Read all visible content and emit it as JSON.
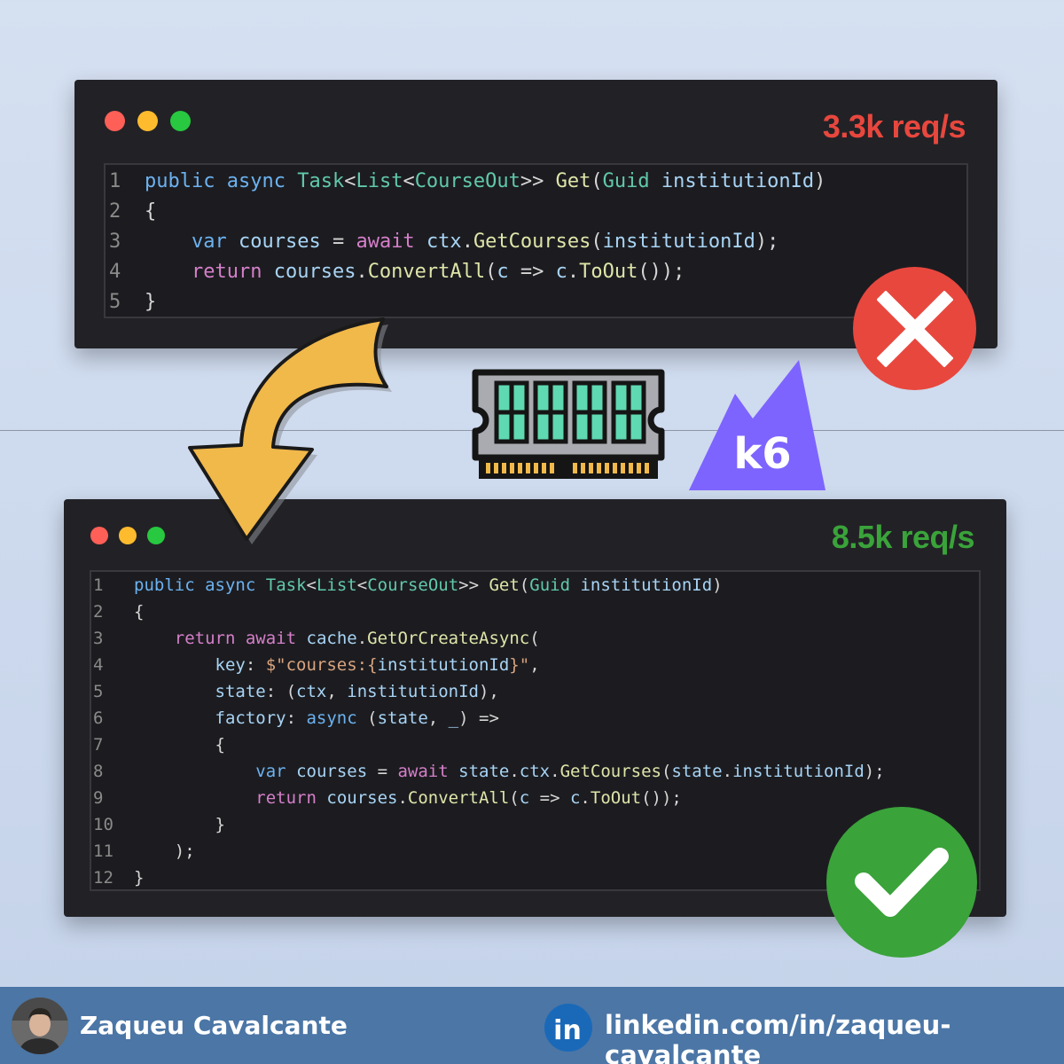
{
  "before": {
    "throughput": "3.3k req/s",
    "code": [
      [
        {
          "t": "public",
          "c": "kw"
        },
        {
          "t": " ",
          "c": "pl"
        },
        {
          "t": "async",
          "c": "kw"
        },
        {
          "t": " ",
          "c": "pl"
        },
        {
          "t": "Task",
          "c": "ty"
        },
        {
          "t": "<",
          "c": "pl"
        },
        {
          "t": "List",
          "c": "ty"
        },
        {
          "t": "<",
          "c": "pl"
        },
        {
          "t": "CourseOut",
          "c": "ty"
        },
        {
          "t": ">> ",
          "c": "pl"
        },
        {
          "t": "Get",
          "c": "fn"
        },
        {
          "t": "(",
          "c": "pl"
        },
        {
          "t": "Guid",
          "c": "ty"
        },
        {
          "t": " ",
          "c": "pl"
        },
        {
          "t": "institutionId",
          "c": "vr"
        },
        {
          "t": ")",
          "c": "pl"
        }
      ],
      [
        {
          "t": "{",
          "c": "pl"
        }
      ],
      [
        {
          "t": "    ",
          "c": "pl"
        },
        {
          "t": "var",
          "c": "kw"
        },
        {
          "t": " ",
          "c": "pl"
        },
        {
          "t": "courses",
          "c": "vr"
        },
        {
          "t": " = ",
          "c": "pl"
        },
        {
          "t": "await",
          "c": "ct"
        },
        {
          "t": " ",
          "c": "pl"
        },
        {
          "t": "ctx",
          "c": "vr"
        },
        {
          "t": ".",
          "c": "pl"
        },
        {
          "t": "GetCourses",
          "c": "fn"
        },
        {
          "t": "(",
          "c": "pl"
        },
        {
          "t": "institutionId",
          "c": "vr"
        },
        {
          "t": ");",
          "c": "pl"
        }
      ],
      [
        {
          "t": "    ",
          "c": "pl"
        },
        {
          "t": "return",
          "c": "ct"
        },
        {
          "t": " ",
          "c": "pl"
        },
        {
          "t": "courses",
          "c": "vr"
        },
        {
          "t": ".",
          "c": "pl"
        },
        {
          "t": "ConvertAll",
          "c": "fn"
        },
        {
          "t": "(",
          "c": "pl"
        },
        {
          "t": "c",
          "c": "vr"
        },
        {
          "t": " => ",
          "c": "pl"
        },
        {
          "t": "c",
          "c": "vr"
        },
        {
          "t": ".",
          "c": "pl"
        },
        {
          "t": "ToOut",
          "c": "fn"
        },
        {
          "t": "());",
          "c": "pl"
        }
      ],
      [
        {
          "t": "}",
          "c": "pl"
        }
      ]
    ]
  },
  "after": {
    "throughput": "8.5k req/s",
    "code": [
      [
        {
          "t": "public",
          "c": "kw"
        },
        {
          "t": " ",
          "c": "pl"
        },
        {
          "t": "async",
          "c": "kw"
        },
        {
          "t": " ",
          "c": "pl"
        },
        {
          "t": "Task",
          "c": "ty"
        },
        {
          "t": "<",
          "c": "pl"
        },
        {
          "t": "List",
          "c": "ty"
        },
        {
          "t": "<",
          "c": "pl"
        },
        {
          "t": "CourseOut",
          "c": "ty"
        },
        {
          "t": ">> ",
          "c": "pl"
        },
        {
          "t": "Get",
          "c": "fn"
        },
        {
          "t": "(",
          "c": "pl"
        },
        {
          "t": "Guid",
          "c": "ty"
        },
        {
          "t": " ",
          "c": "pl"
        },
        {
          "t": "institutionId",
          "c": "vr"
        },
        {
          "t": ")",
          "c": "pl"
        }
      ],
      [
        {
          "t": "{",
          "c": "pl"
        }
      ],
      [
        {
          "t": "    ",
          "c": "pl"
        },
        {
          "t": "return",
          "c": "ct"
        },
        {
          "t": " ",
          "c": "pl"
        },
        {
          "t": "await",
          "c": "ct"
        },
        {
          "t": " ",
          "c": "pl"
        },
        {
          "t": "cache",
          "c": "vr"
        },
        {
          "t": ".",
          "c": "pl"
        },
        {
          "t": "GetOrCreateAsync",
          "c": "fn"
        },
        {
          "t": "(",
          "c": "pl"
        }
      ],
      [
        {
          "t": "        ",
          "c": "pl"
        },
        {
          "t": "key",
          "c": "vr"
        },
        {
          "t": ": ",
          "c": "pl"
        },
        {
          "t": "$\"courses:{",
          "c": "st"
        },
        {
          "t": "institutionId",
          "c": "vr"
        },
        {
          "t": "}\"",
          "c": "st"
        },
        {
          "t": ",",
          "c": "pl"
        }
      ],
      [
        {
          "t": "        ",
          "c": "pl"
        },
        {
          "t": "state",
          "c": "vr"
        },
        {
          "t": ": (",
          "c": "pl"
        },
        {
          "t": "ctx",
          "c": "vr"
        },
        {
          "t": ", ",
          "c": "pl"
        },
        {
          "t": "institutionId",
          "c": "vr"
        },
        {
          "t": "),",
          "c": "pl"
        }
      ],
      [
        {
          "t": "        ",
          "c": "pl"
        },
        {
          "t": "factory",
          "c": "vr"
        },
        {
          "t": ": ",
          "c": "pl"
        },
        {
          "t": "async",
          "c": "kw"
        },
        {
          "t": " (",
          "c": "pl"
        },
        {
          "t": "state",
          "c": "vr"
        },
        {
          "t": ", ",
          "c": "pl"
        },
        {
          "t": "_",
          "c": "vr"
        },
        {
          "t": ") =>",
          "c": "pl"
        }
      ],
      [
        {
          "t": "        {",
          "c": "pl"
        }
      ],
      [
        {
          "t": "            ",
          "c": "pl"
        },
        {
          "t": "var",
          "c": "kw"
        },
        {
          "t": " ",
          "c": "pl"
        },
        {
          "t": "courses",
          "c": "vr"
        },
        {
          "t": " = ",
          "c": "pl"
        },
        {
          "t": "await",
          "c": "ct"
        },
        {
          "t": " ",
          "c": "pl"
        },
        {
          "t": "state",
          "c": "vr"
        },
        {
          "t": ".",
          "c": "pl"
        },
        {
          "t": "ctx",
          "c": "vr"
        },
        {
          "t": ".",
          "c": "pl"
        },
        {
          "t": "GetCourses",
          "c": "fn"
        },
        {
          "t": "(",
          "c": "pl"
        },
        {
          "t": "state",
          "c": "vr"
        },
        {
          "t": ".",
          "c": "pl"
        },
        {
          "t": "institutionId",
          "c": "vr"
        },
        {
          "t": ");",
          "c": "pl"
        }
      ],
      [
        {
          "t": "            ",
          "c": "pl"
        },
        {
          "t": "return",
          "c": "ct"
        },
        {
          "t": " ",
          "c": "pl"
        },
        {
          "t": "courses",
          "c": "vr"
        },
        {
          "t": ".",
          "c": "pl"
        },
        {
          "t": "ConvertAll",
          "c": "fn"
        },
        {
          "t": "(",
          "c": "pl"
        },
        {
          "t": "c",
          "c": "vr"
        },
        {
          "t": " => ",
          "c": "pl"
        },
        {
          "t": "c",
          "c": "vr"
        },
        {
          "t": ".",
          "c": "pl"
        },
        {
          "t": "ToOut",
          "c": "fn"
        },
        {
          "t": "());",
          "c": "pl"
        }
      ],
      [
        {
          "t": "        }",
          "c": "pl"
        }
      ],
      [
        {
          "t": "    );",
          "c": "pl"
        }
      ],
      [
        {
          "t": "}",
          "c": "pl"
        }
      ]
    ]
  },
  "k6_label": "k6",
  "footer": {
    "author": "Zaqueu Cavalcante",
    "linkedin": "linkedin.com/in/zaqueu-cavalcante",
    "linkedin_icon_text": "in"
  },
  "icons": {
    "fail": "cross-icon",
    "success": "checkmark-icon",
    "memory": "ram-icon",
    "arrow": "curved-arrow-icon",
    "tool": "k6-logo",
    "social": "linkedin-icon"
  },
  "colors": {
    "fail": "#e8473e",
    "success": "#3aa33a",
    "arrow": "#f1b84a",
    "k6": "#7d64ff",
    "footer": "#4b76a6"
  }
}
